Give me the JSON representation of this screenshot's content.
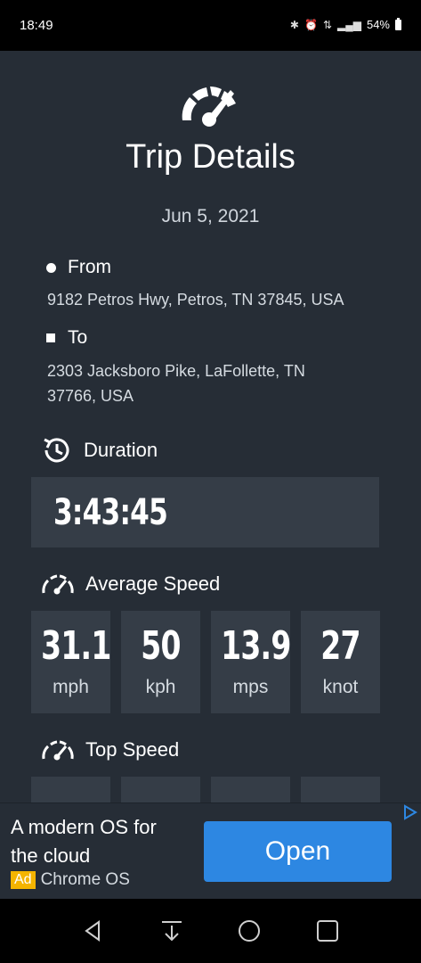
{
  "status_bar": {
    "time": "18:49",
    "battery": "54%",
    "icons": [
      "bluetooth-icon",
      "alarm-icon",
      "data-icon",
      "signal-icon",
      "battery-icon"
    ]
  },
  "header": {
    "title": "Trip Details",
    "date": "Jun 5, 2021",
    "logo_icon": "speedometer-icon"
  },
  "from": {
    "label": "From",
    "address": "9182 Petros Hwy, Petros, TN 37845, USA"
  },
  "to": {
    "label": "To",
    "address_line1": "2303 Jacksboro Pike, LaFollette, TN",
    "address_line2": "37766, USA"
  },
  "duration": {
    "label": "Duration",
    "value": "3:43:45",
    "icon": "clock-history-icon"
  },
  "average_speed": {
    "label": "Average Speed",
    "icon": "speedometer-icon",
    "cards": [
      {
        "value": "31.1",
        "unit": "mph"
      },
      {
        "value": "50",
        "unit": "kph"
      },
      {
        "value": "13.9",
        "unit": "mps"
      },
      {
        "value": "27",
        "unit": "knot"
      }
    ]
  },
  "top_speed": {
    "label": "Top Speed",
    "icon": "speedometer-icon"
  },
  "ad": {
    "text_line1": "A modern OS for",
    "text_line2": "the cloud",
    "badge": "Ad",
    "advertiser": "Chrome OS",
    "button": "Open",
    "choices_icon": "ad-choices-icon"
  },
  "colors": {
    "background": "#262d36",
    "card": "#353d47",
    "button": "#2d87e2",
    "ad_badge": "#f4b400"
  }
}
